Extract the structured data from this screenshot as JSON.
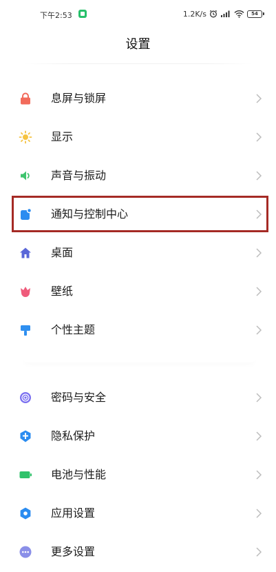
{
  "status": {
    "time": "下午2:53",
    "speed": "1.2K/s",
    "battery": "54"
  },
  "title": "设置",
  "groups": [
    {
      "items": [
        {
          "label": "息屏与锁屏",
          "icon": "lock-icon",
          "color": "#f26b5b"
        },
        {
          "label": "显示",
          "icon": "sun-icon",
          "color": "#f5c342"
        },
        {
          "label": "声音与振动",
          "icon": "speaker-icon",
          "color": "#3ec46d"
        },
        {
          "label": "通知与控制中心",
          "icon": "notification-icon",
          "color": "#2b8cf0"
        },
        {
          "label": "桌面",
          "icon": "home-icon",
          "color": "#5a67d8"
        },
        {
          "label": "壁纸",
          "icon": "tulip-icon",
          "color": "#ef5b7b"
        },
        {
          "label": "个性主题",
          "icon": "brush-icon",
          "color": "#2f8ff0"
        }
      ]
    },
    {
      "items": [
        {
          "label": "密码与安全",
          "icon": "fingerprint-icon",
          "color": "#7a6ff0"
        },
        {
          "label": "隐私保护",
          "icon": "privacy-icon",
          "color": "#2b8cf0"
        },
        {
          "label": "电池与性能",
          "icon": "battery-icon",
          "color": "#2fc26a"
        },
        {
          "label": "应用设置",
          "icon": "app-gear-icon",
          "color": "#2b8cf0"
        },
        {
          "label": "更多设置",
          "icon": "more-icon",
          "color": "#8a8fe8"
        }
      ]
    }
  ],
  "highlight_color": "#a52a25"
}
